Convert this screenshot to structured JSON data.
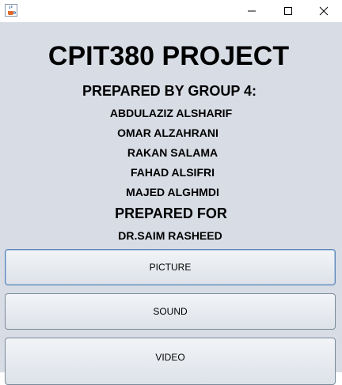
{
  "window": {
    "app_icon": "java-cup-icon",
    "controls": [
      "minimize-icon",
      "maximize-icon",
      "close-icon"
    ]
  },
  "title": "CPIT380 PROJECT",
  "prepared_by_label": "PREPARED BY GROUP 4:",
  "members": [
    "ABDULAZIZ ALSHARIF",
    "OMAR ALZAHRANI",
    "RAKAN SALAMA",
    "FAHAD ALSIFRI",
    "MAJED ALGHMDI"
  ],
  "prepared_for_label": "PREPARED FOR",
  "supervisor": "DR.SAIM RASHEED",
  "buttons": {
    "picture": "PICTURE",
    "sound": "SOUND",
    "video": "VIDEO"
  },
  "colors": {
    "background": "#d7dce5",
    "focus_border": "#5f87b6"
  }
}
